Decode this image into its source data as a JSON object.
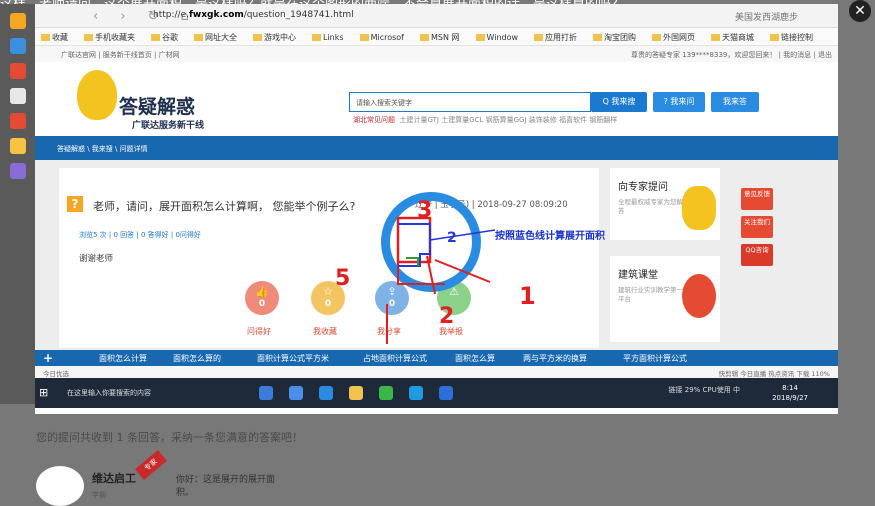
{
  "caption": "这样，老师请问，这个展开面积，是这样吗？就是在这个图形的两端，不会算展开面积的话，是这样算的吗？",
  "browser": {
    "url_prefix": "http://e.",
    "url_domain": "fwxgk.com",
    "url_path": "/question_1948741.html",
    "title_right": "美国发西湖鹿步",
    "bookmarks": [
      "收藏",
      "手机收藏夹",
      "谷歌",
      "网址大全",
      "游戏中心",
      "Links",
      "Microsof",
      "MSN 网",
      "Window",
      "应用打折",
      "淘宝团购",
      "外国网页",
      "天猫商城",
      "链接控制"
    ]
  },
  "site": {
    "topnav_left": "广联达官网  |  服务新干线首页  |  广材网",
    "topnav_right": "尊贵的答疑专家  139****8339，欢迎您回来！  |  我的消息  |  退出",
    "brand": "答疑解惑",
    "brand_sub": "广联达服务新干线",
    "search_placeholder": "请输入搜索关键字",
    "btn_search": "Q 我来搜",
    "btn_ask": "? 我来问",
    "btn_answer": "我来答",
    "hot_label": "湖北常见问题",
    "hot_items": "土建计量GTJ   土建算量GCL   钢筋算量GGJ   装饰装修   福喜软件   钢筋翻样",
    "breadcrumb": "答疑解惑 \\ 我来搜 \\ 问题详情"
  },
  "question": {
    "title": "老师，请问，展开面积怎么计算啊， 您能举个例子么?",
    "meta": "辽宁 | 玉小子) | 2018-09-27 08:09:20",
    "stats": "浏览5 次 | 0 回答 | 0 答得好 | 0问得好",
    "body": "谢谢老师",
    "actions": [
      {
        "label": "问得好",
        "value": "0",
        "color": "#f08a7a"
      },
      {
        "label": "我收藏",
        "value": "0",
        "color": "#f3c462"
      },
      {
        "label": "我分享",
        "value": "0",
        "color": "#7fb3e6"
      },
      {
        "label": "我举报",
        "value": "",
        "color": "#8ad18a"
      }
    ]
  },
  "sidebar": {
    "expert_title": "向专家提问",
    "expert_desc": "全程最权威专家为您解答",
    "course_title": "建筑课堂",
    "course_desc": "建筑行业实训教学第一平台",
    "float_buttons": [
      "意见反馈",
      "关注我们",
      "QQ咨询"
    ]
  },
  "annotations": {
    "note": "按照蓝色线计算展开面积",
    "digits": [
      "3",
      "2",
      "5",
      "1",
      "2"
    ]
  },
  "tabs": [
    "面积怎么计算",
    "面积怎么算的",
    "面积计算公式平方米",
    "占地面积计算公式",
    "面积怎么算",
    "两与平方米的换算",
    "平方面积计算公式"
  ],
  "statusbar": {
    "left": "今日优选",
    "right": "快剪辑   今日直播   热点资讯   下载   110%"
  },
  "taskbar": {
    "search": "在这里输入你要搜索的内容",
    "tray": "链接  29% CPU使用  中",
    "time": "8:14",
    "date": "2018/9/27"
  },
  "page": {
    "answers_summary": "您的提问共收到 1 条回答，采纳一条您满意的答案吧！",
    "answerer_name": "维达启工",
    "answerer_sub": "学霸",
    "ribbon": "专家",
    "answer_text": "你好：这是展开的展开面积。"
  }
}
